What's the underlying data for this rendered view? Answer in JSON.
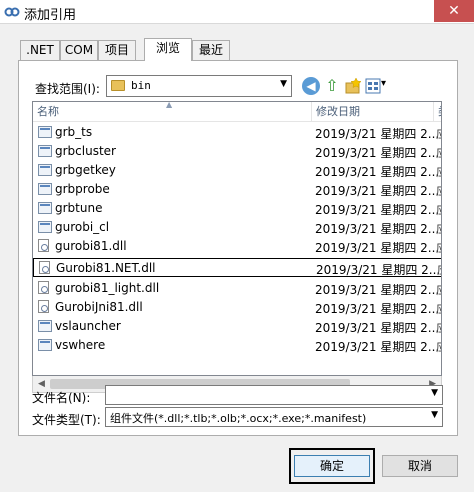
{
  "window": {
    "title": "添加引用",
    "close_glyph": "✕"
  },
  "tabs": [
    {
      "label": ".NET"
    },
    {
      "label": "COM"
    },
    {
      "label": "项目"
    },
    {
      "label": "浏览",
      "active": true
    },
    {
      "label": "最近"
    }
  ],
  "lookin": {
    "label": "查找范围(I):",
    "value": "bin"
  },
  "toolbar": {
    "back_glyph": "◀",
    "up_glyph": "⇧",
    "view_caret": "▾"
  },
  "columns": {
    "name": "名称",
    "date": "修改日期",
    "type": "类"
  },
  "files": [
    {
      "name": "grb_ts",
      "date": "2019/3/21 星期四 2...",
      "type": "应",
      "icon": "exe-icon"
    },
    {
      "name": "grbcluster",
      "date": "2019/3/21 星期四 2...",
      "type": "应",
      "icon": "exe-icon"
    },
    {
      "name": "grbgetkey",
      "date": "2019/3/21 星期四 2...",
      "type": "应",
      "icon": "exe-icon"
    },
    {
      "name": "grbprobe",
      "date": "2019/3/21 星期四 2...",
      "type": "应",
      "icon": "exe-icon"
    },
    {
      "name": "grbtune",
      "date": "2019/3/21 星期四 2...",
      "type": "应",
      "icon": "exe-icon"
    },
    {
      "name": "gurobi_cl",
      "date": "2019/3/21 星期四 2...",
      "type": "应",
      "icon": "exe-icon"
    },
    {
      "name": "gurobi81.dll",
      "date": "2019/3/21 星期四 2...",
      "type": "应",
      "icon": "dll-icon"
    },
    {
      "name": "Gurobi81.NET.dll",
      "date": "2019/3/21 星期四 2...",
      "type": "应",
      "icon": "dll-icon",
      "selected": true
    },
    {
      "name": "gurobi81_light.dll",
      "date": "2019/3/21 星期四 2...",
      "type": "应",
      "icon": "dll-icon"
    },
    {
      "name": "GurobiJni81.dll",
      "date": "2019/3/21 星期四 2...",
      "type": "应",
      "icon": "dll-icon"
    },
    {
      "name": "vslauncher",
      "date": "2019/3/21 星期四 2...",
      "type": "应",
      "icon": "exe-icon"
    },
    {
      "name": "vswhere",
      "date": "2019/3/21 星期四 2...",
      "type": "应",
      "icon": "exe-icon"
    }
  ],
  "filename": {
    "label": "文件名(N):",
    "value": ""
  },
  "filetype": {
    "label": "文件类型(T):",
    "value": "组件文件(*.dll;*.tlb;*.olb;*.ocx;*.exe;*.manifest)"
  },
  "buttons": {
    "ok": "确定",
    "cancel": "取消"
  }
}
